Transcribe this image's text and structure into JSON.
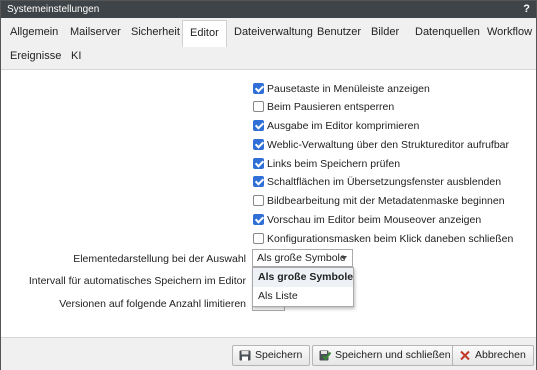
{
  "window": {
    "title": "Systemeinstellungen",
    "help_label": "?"
  },
  "tabs": [
    {
      "label": "Allgemein"
    },
    {
      "label": "Mailserver"
    },
    {
      "label": "Sicherheit"
    },
    {
      "label": "Editor",
      "active": true
    },
    {
      "label": "Dateiverwaltung"
    },
    {
      "label": "Benutzer"
    },
    {
      "label": "Bilder"
    },
    {
      "label": "Datenquellen"
    },
    {
      "label": "Workflow"
    },
    {
      "label": "Ereignisse"
    },
    {
      "label": "KI"
    }
  ],
  "options": [
    {
      "label": "Pausetaste in Menüleiste anzeigen",
      "checked": true
    },
    {
      "label": "Beim Pausieren entsperren",
      "checked": false
    },
    {
      "label": "Ausgabe im Editor komprimieren",
      "checked": true
    },
    {
      "label": "Weblic-Verwaltung über den Struktureditor aufrufbar",
      "checked": true
    },
    {
      "label": "Links beim Speichern prüfen",
      "checked": true
    },
    {
      "label": "Schaltflächen im Übersetzungsfenster ausblenden",
      "checked": true
    },
    {
      "label": "Bildbearbeitung mit der Metadatenmaske beginnen",
      "checked": false
    },
    {
      "label": "Vorschau im Editor beim Mouseover anzeigen",
      "checked": true
    },
    {
      "label": "Konfigurationsmasken beim Klick daneben schließen",
      "checked": false
    }
  ],
  "fields": {
    "element_display_label": "Elementedarstellung bei der Auswahl",
    "element_display_value": "Als große Symbole",
    "autosave_label": "Intervall für automatisches Speichern im Editor",
    "versions_label": "Versionen auf folgende Anzahl limitieren"
  },
  "dropdown_options": [
    {
      "label": "Als große Symbole",
      "selected": true
    },
    {
      "label": "Als Liste",
      "selected": false
    }
  ],
  "footer": {
    "save_label": "Speichern",
    "save_close_label": "Speichern und schließen",
    "cancel_label": "Abbrechen"
  },
  "colors": {
    "titlebar": "#3f4448",
    "checkbox_checked": "#2f6fd6",
    "cancel_icon": "#c0392b",
    "save_close_icon": "#3a8a3a"
  }
}
